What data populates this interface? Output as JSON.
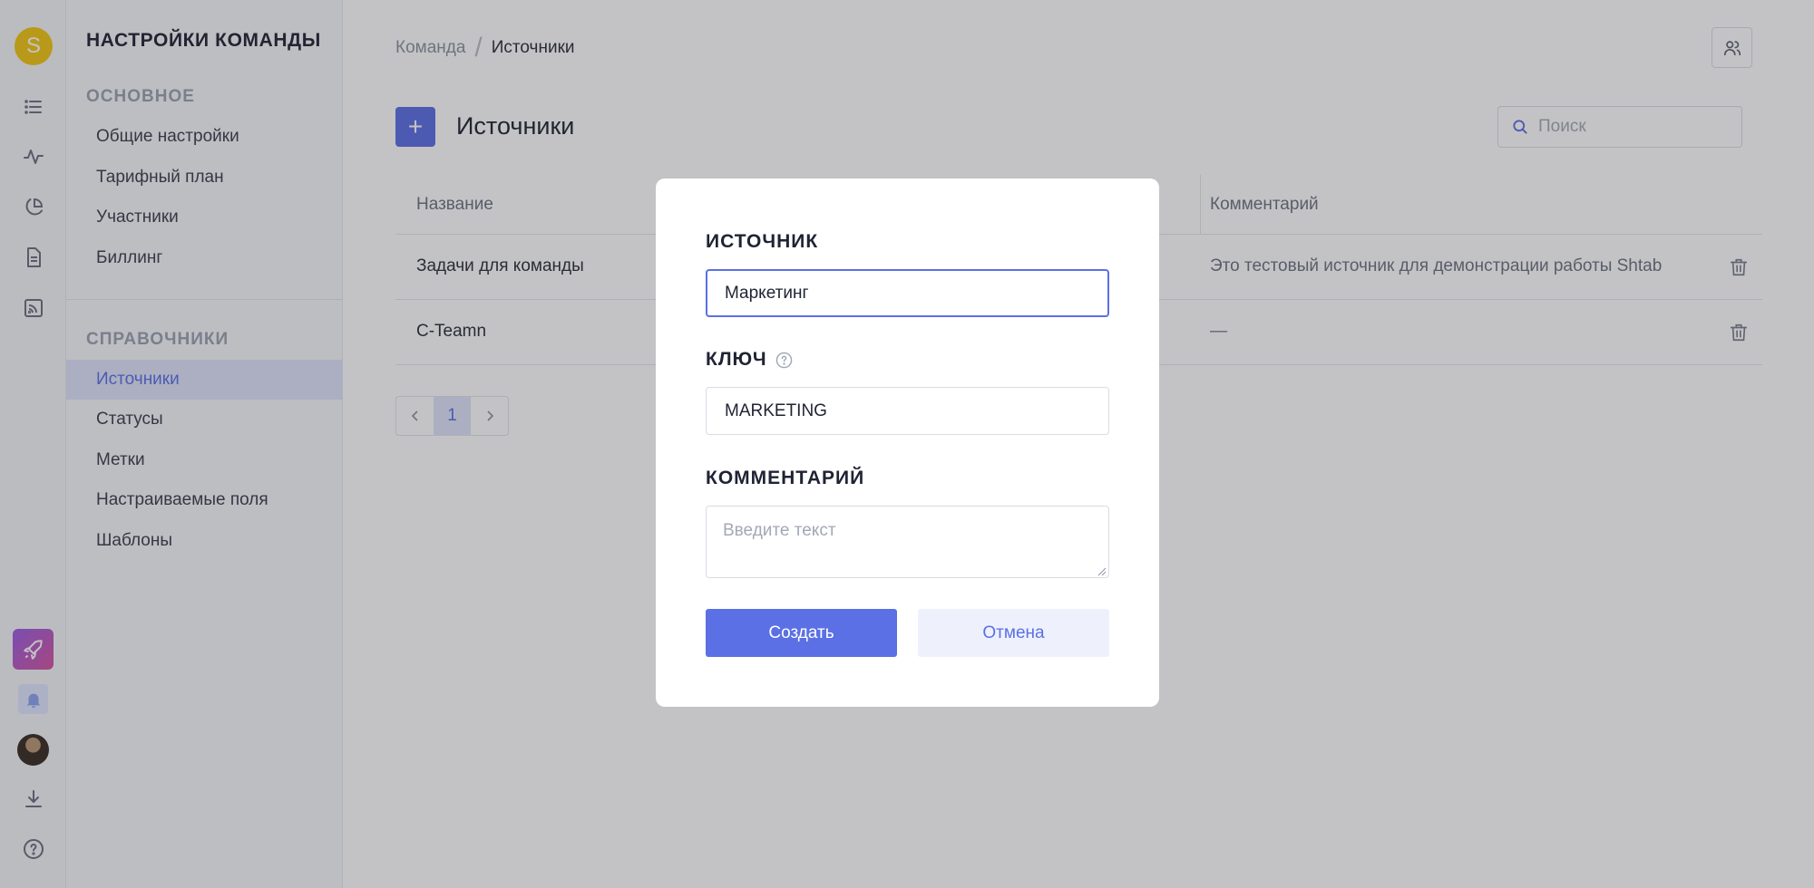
{
  "rail": {
    "avatar_letter": "S",
    "icons": [
      "list-icon",
      "activity-icon",
      "pie-chart-icon",
      "document-icon",
      "feed-icon",
      "rocket-icon",
      "bell-icon",
      "user-avatar",
      "download-icon",
      "help-icon"
    ]
  },
  "sidebar": {
    "title": "НАСТРОЙКИ КОМАНДЫ",
    "sections": [
      {
        "title": "ОСНОВНОЕ",
        "items": [
          "Общие настройки",
          "Тарифный план",
          "Участники",
          "Биллинг"
        ]
      },
      {
        "title": "СПРАВОЧНИКИ",
        "items": [
          "Источники",
          "Статусы",
          "Метки",
          "Настраиваемые поля",
          "Шаблоны"
        ]
      }
    ],
    "active_item": "Источники"
  },
  "breadcrumb": {
    "parent": "Команда",
    "separator": "/",
    "current": "Источники"
  },
  "page": {
    "title": "Источники",
    "add_label": "+",
    "search_placeholder": "Поиск"
  },
  "table": {
    "headers": [
      "Название",
      "Комментарий"
    ],
    "rows": [
      {
        "name": "Задачи для команды",
        "comment": "Это тестовый источник для демонстрации работы Shtab"
      },
      {
        "name": "C-Teamn",
        "comment": "—"
      }
    ]
  },
  "pagination": {
    "current": "1"
  },
  "modal": {
    "source_label": "ИСТОЧНИК",
    "source_value": "Маркетинг",
    "key_label": "КЛЮЧ",
    "key_value": "MARKETING",
    "comment_label": "КОММЕНТАРИЙ",
    "comment_placeholder": "Введите текст",
    "create_label": "Создать",
    "cancel_label": "Отмена"
  },
  "colors": {
    "accent": "#5b70e4",
    "avatar": "#f2c511",
    "active_bg": "#dfe4fb"
  }
}
